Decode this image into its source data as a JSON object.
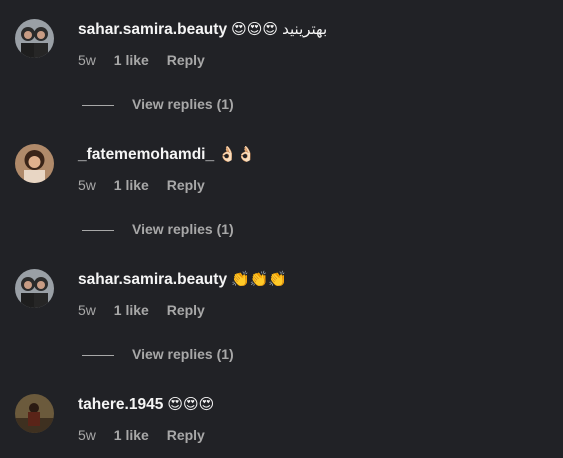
{
  "comments": [
    {
      "username": "sahar.samira.beauty",
      "text": "😍😍😍 بهترینید",
      "time": "5w",
      "likes": "1 like",
      "reply": "Reply",
      "view_replies": "View replies (1)"
    },
    {
      "username": "_fatememohamdi_",
      "text": "👌🏻👌🏻",
      "time": "5w",
      "likes": "1 like",
      "reply": "Reply",
      "view_replies": "View replies (1)"
    },
    {
      "username": "sahar.samira.beauty",
      "text": "👏👏👏",
      "time": "5w",
      "likes": "1 like",
      "reply": "Reply",
      "view_replies": "View replies (1)"
    },
    {
      "username": "tahere.1945",
      "text": "😍😍😍",
      "time": "5w",
      "likes": "1 like",
      "reply": "Reply"
    }
  ],
  "colors": {
    "background": "#212226",
    "text": "#f5f5f5",
    "muted": "#a8a8a8"
  }
}
